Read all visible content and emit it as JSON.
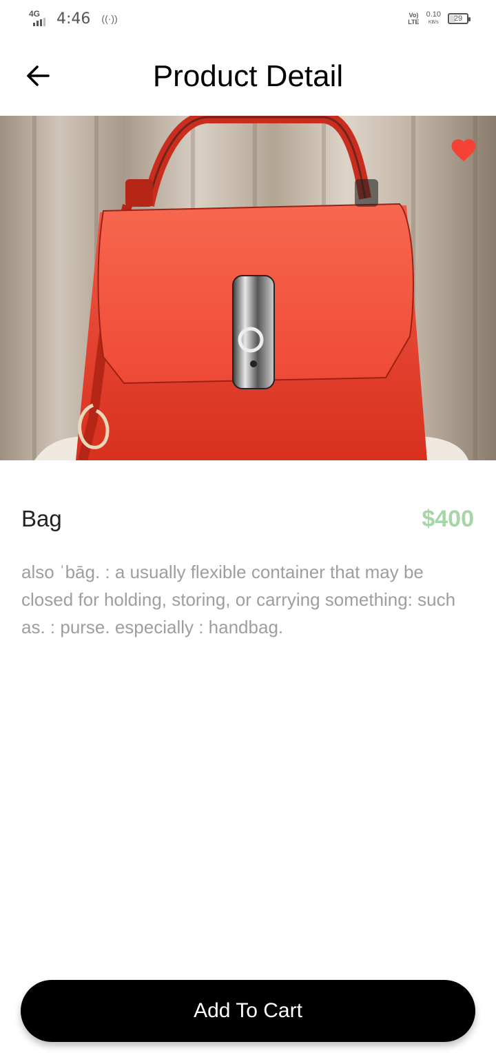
{
  "status_bar": {
    "network": "4G",
    "time": "4:46",
    "hotspot": "((·))",
    "volte_top": "Vo)",
    "volte_bottom": "LTE",
    "speed": "0.10",
    "speed_unit": "KB/s",
    "battery": "29"
  },
  "app_bar": {
    "title": "Product Detail",
    "back_icon": "arrow-left-icon"
  },
  "product": {
    "image_icon": "red-handbag-photo",
    "favorite_icon": "heart-icon",
    "favorite_color": "#f44336",
    "name": "Bag",
    "price": "$400",
    "price_color": "#a5d6a7",
    "description": "also ˈbāg. : a usually flexible container that may be closed for holding, storing, or carrying something: such as. : purse. especially : handbag."
  },
  "actions": {
    "add_to_cart": "Add To Cart"
  }
}
